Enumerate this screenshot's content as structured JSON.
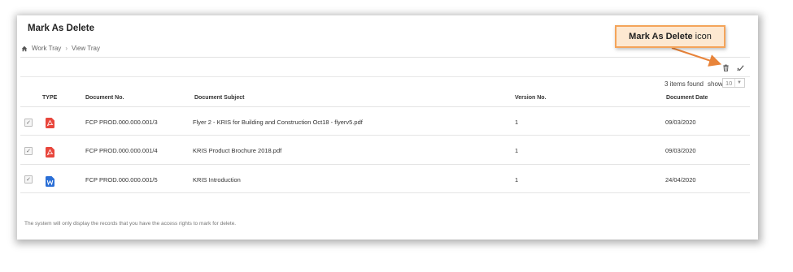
{
  "header": {
    "title": "Mark As Delete",
    "breadcrumb": [
      {
        "label": "Work Tray"
      },
      {
        "label": "View Tray"
      }
    ]
  },
  "toolbar": {
    "icons": [
      "trash-icon",
      "checkmark-icon"
    ]
  },
  "paging": {
    "items_found": "3 items found",
    "show_label": "show",
    "page_size": "10"
  },
  "table": {
    "columns": {
      "type": "TYPE",
      "doc_no": "Document No.",
      "subject": "Document Subject",
      "version": "Version No.",
      "date": "Document Date"
    },
    "rows": [
      {
        "checked": "✓",
        "file_type": "pdf",
        "doc_no": "FCP PROD.000.000.001/3",
        "subject": "Flyer 2 - KRIS for Building and Construction Oct18 - flyerv5.pdf",
        "version": "1",
        "date": "09/03/2020"
      },
      {
        "checked": "✓",
        "file_type": "pdf",
        "doc_no": "FCP PROD.000.000.001/4",
        "subject": "KRIS Product Brochure 2018.pdf",
        "version": "1",
        "date": "09/03/2020"
      },
      {
        "checked": "✓",
        "file_type": "word",
        "doc_no": "FCP PROD.000.000.001/5",
        "subject": "KRIS Introduction",
        "version": "1",
        "date": "24/04/2020"
      }
    ]
  },
  "footer": {
    "note": "The system will only display the records that you have the access rights to mark for delete."
  },
  "annotation": {
    "callout_bold": "Mark As Delete",
    "callout_rest": "icon"
  },
  "colors": {
    "pdf": "#e8463c",
    "word": "#2b6fd6",
    "callout_fill": "#fde8d1",
    "callout_border": "#f4a45a",
    "arrow": "#e8843a"
  }
}
